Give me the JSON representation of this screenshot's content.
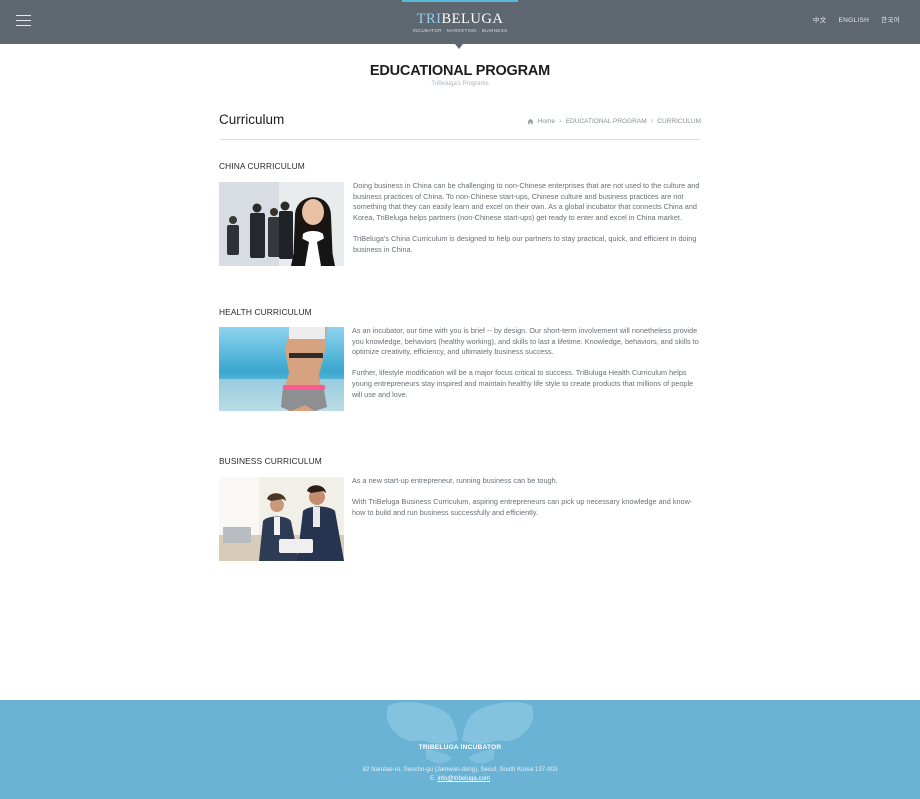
{
  "header": {
    "logo_prefix": "TRI",
    "logo_suffix": "BELUGA",
    "logo_tagline": "INCUBATOR · MARKETING · BUSINESS",
    "menu_icon": "hamburger-icon",
    "languages": [
      "中文",
      "ENGLISH",
      "한국어"
    ],
    "accent_color": "#5bb8d9",
    "bg_color": "#5e6670"
  },
  "page": {
    "title": "EDUCATIONAL PROGRAM",
    "subtitle": "TriBeluga's Programs"
  },
  "section": {
    "heading": "Curriculum",
    "breadcrumb": {
      "home_icon": "home-icon",
      "items": [
        "Home",
        "EDUCATIONAL PROGRAM",
        "CURRICULUM"
      ]
    }
  },
  "curricula": [
    {
      "title": "CHINA CURRICULUM",
      "image": "business-people-photo",
      "paragraphs": [
        "Doing business in China can be challenging to non-Chinese enterprises that are not used to the culture and business practices of China. To non-Chinese start-ups, Chinese culture and business practices are not something that they can easily learn and excel on their own. As a global incubator that connects China and Korea, TriBeluga helps partners (non-Chinese start-ups) get ready to enter and excel in China market.",
        "TriBeluga's China Curriculum is designed to help our partners to stay practical, quick, and efficient in doing business in China."
      ]
    },
    {
      "title": "HEALTH CURRICULUM",
      "image": "fitness-beach-photo",
      "paragraphs": [
        "As an incubator, our time with you is brief -- by design. Our short-term involvement will nonetheless provide you knowledge, behaviors (healthy working), and skills to last a lifetime. Knowledge, behaviors, and skills to optimize creativity, efficiency, and ultimately business success.",
        "Further, lifestyle modification will be a major focus critical to success. TriBuluga Health Curriculum helps young entrepreneurs stay inspired and maintain healthy life style to create products that millions of people will use and love."
      ]
    },
    {
      "title": "BUSINESS CURRICULUM",
      "image": "business-meeting-photo",
      "paragraphs": [
        "As a new start-up entrepreneur, running business can be tough.",
        "With TriBeluga Business Curriculum, aspiring entrepreneurs can pick up necessary knowledge and know-how to build and run business successfully and efficiently."
      ]
    }
  ],
  "footer": {
    "name": "TRIBELUGA INCUBATOR",
    "address": "82 Narutae-ro, Seocho-gu (Jamwon-dong), Seoul, South Korea 137-903",
    "email_prefix": "E.",
    "email": "info@tribeluga.com",
    "bg_color": "#6ab3d5",
    "map_icon": "world-map-icon"
  }
}
